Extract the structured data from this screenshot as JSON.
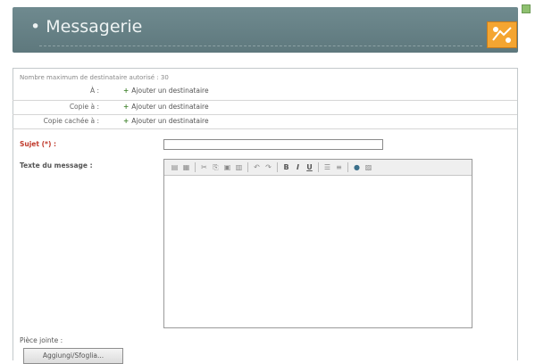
{
  "header": {
    "title": "• Messagerie"
  },
  "form": {
    "max_recipients_note": "Nombre maximum de destinataire autorisé : 30",
    "to_label": "À :",
    "cc_label": "Copie à :",
    "bcc_label": "Copie cachée à :",
    "add_recipient": "Ajouter un destinataire",
    "subject_label": "Sujet (*) :",
    "subject_value": "",
    "body_label": "Texte du message :",
    "attachment_label": "Pièce jointe :",
    "browse_button": "Aggiungi/Sfoglia..."
  },
  "toolbar": {
    "bold": "B",
    "italic": "I",
    "underline": "U"
  },
  "colors": {
    "header_bg": "#6f8a8f",
    "required": "#c0392b",
    "add_plus": "#4c8a3a"
  }
}
